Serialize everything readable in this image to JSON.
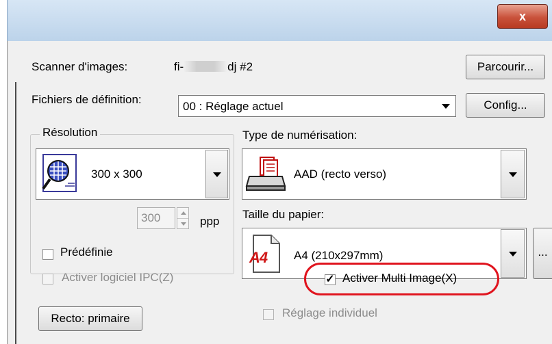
{
  "window": {
    "close_glyph": "x"
  },
  "scanner": {
    "label": "Scanner d'images:",
    "name_prefix": "fi-",
    "name_suffix": "dj #2",
    "browse_label": "Parcourir..."
  },
  "definition": {
    "label": "Fichiers de définition:",
    "value": "00 : Réglage actuel",
    "config_label": "Config..."
  },
  "resolution": {
    "group_label": "Résolution",
    "value": "300 x 300",
    "spin_value": "300",
    "unit": "ppp",
    "preset_label": "Prédéfinie",
    "preset_checked": false
  },
  "scan_type": {
    "label": "Type de numérisation:",
    "value": "AAD (recto verso)"
  },
  "paper": {
    "label": "Taille du papier:",
    "icon_text": "A4",
    "value": "A4 (210x297mm)",
    "more_label": "..."
  },
  "ipc": {
    "label": "Activer logiciel IPC(Z)",
    "checked": false,
    "enabled": false
  },
  "multi_image": {
    "label": "Activer Multi Image(X)",
    "checked": true
  },
  "side": {
    "button_label": "Recto: primaire"
  },
  "individual": {
    "label": "Réglage individuel",
    "checked": false,
    "enabled": false
  },
  "colors": {
    "highlight": "#e0141e",
    "panel": "#f0f0f0"
  }
}
